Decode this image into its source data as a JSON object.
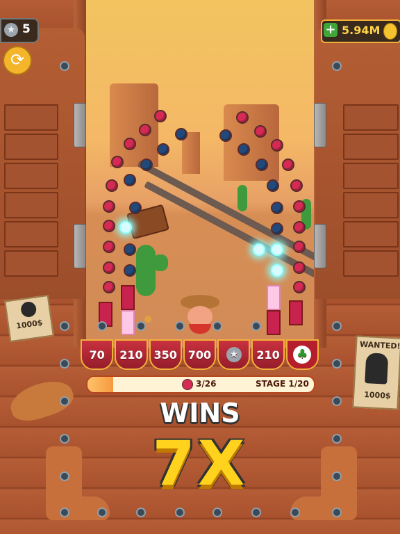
{
  "hud": {
    "stars_count": "5",
    "coins_amount": "5.94M"
  },
  "slots": [
    "70",
    "210",
    "350",
    "700",
    "",
    "210",
    ""
  ],
  "slot_icons": {
    "slot_5": "silver-star-icon",
    "slot_7": "four-leaf-clover-icon"
  },
  "progress": {
    "gems_text": "3/26",
    "gems_fraction": 0.115,
    "stage_text": "STAGE 1/20"
  },
  "result": {
    "wins_label": "WINS",
    "multiplier": "7X"
  },
  "posters": {
    "right_title": "WANTED!",
    "right_reward": "1000$",
    "left_reward": "1000$"
  },
  "colors": {
    "accent_gold": "#f2b03a",
    "peg_red": "#d42a53",
    "peg_blue": "#22497c",
    "multiplier_yellow": "#ffd21e"
  }
}
